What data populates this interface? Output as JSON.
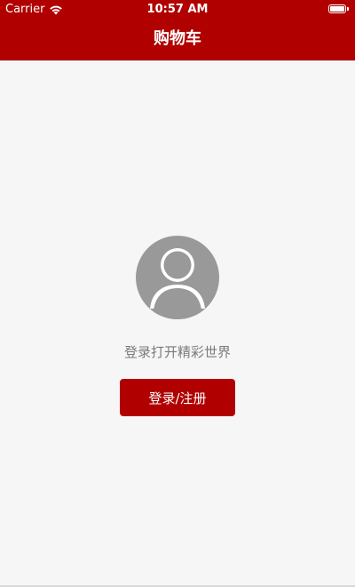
{
  "status_bar": {
    "carrier": "Carrier",
    "time": "10:57 AM",
    "wifi_icon": "wifi-icon",
    "battery_icon": "battery-icon"
  },
  "nav": {
    "title": "购物车"
  },
  "empty_state": {
    "avatar_icon": "user-avatar-icon",
    "prompt": "登录打开精彩世界",
    "login_button_label": "登录/注册"
  },
  "colors": {
    "brand": "#b00000",
    "background": "#f6f6f6",
    "avatar": "#999999",
    "prompt_text": "#7b7b7b"
  }
}
